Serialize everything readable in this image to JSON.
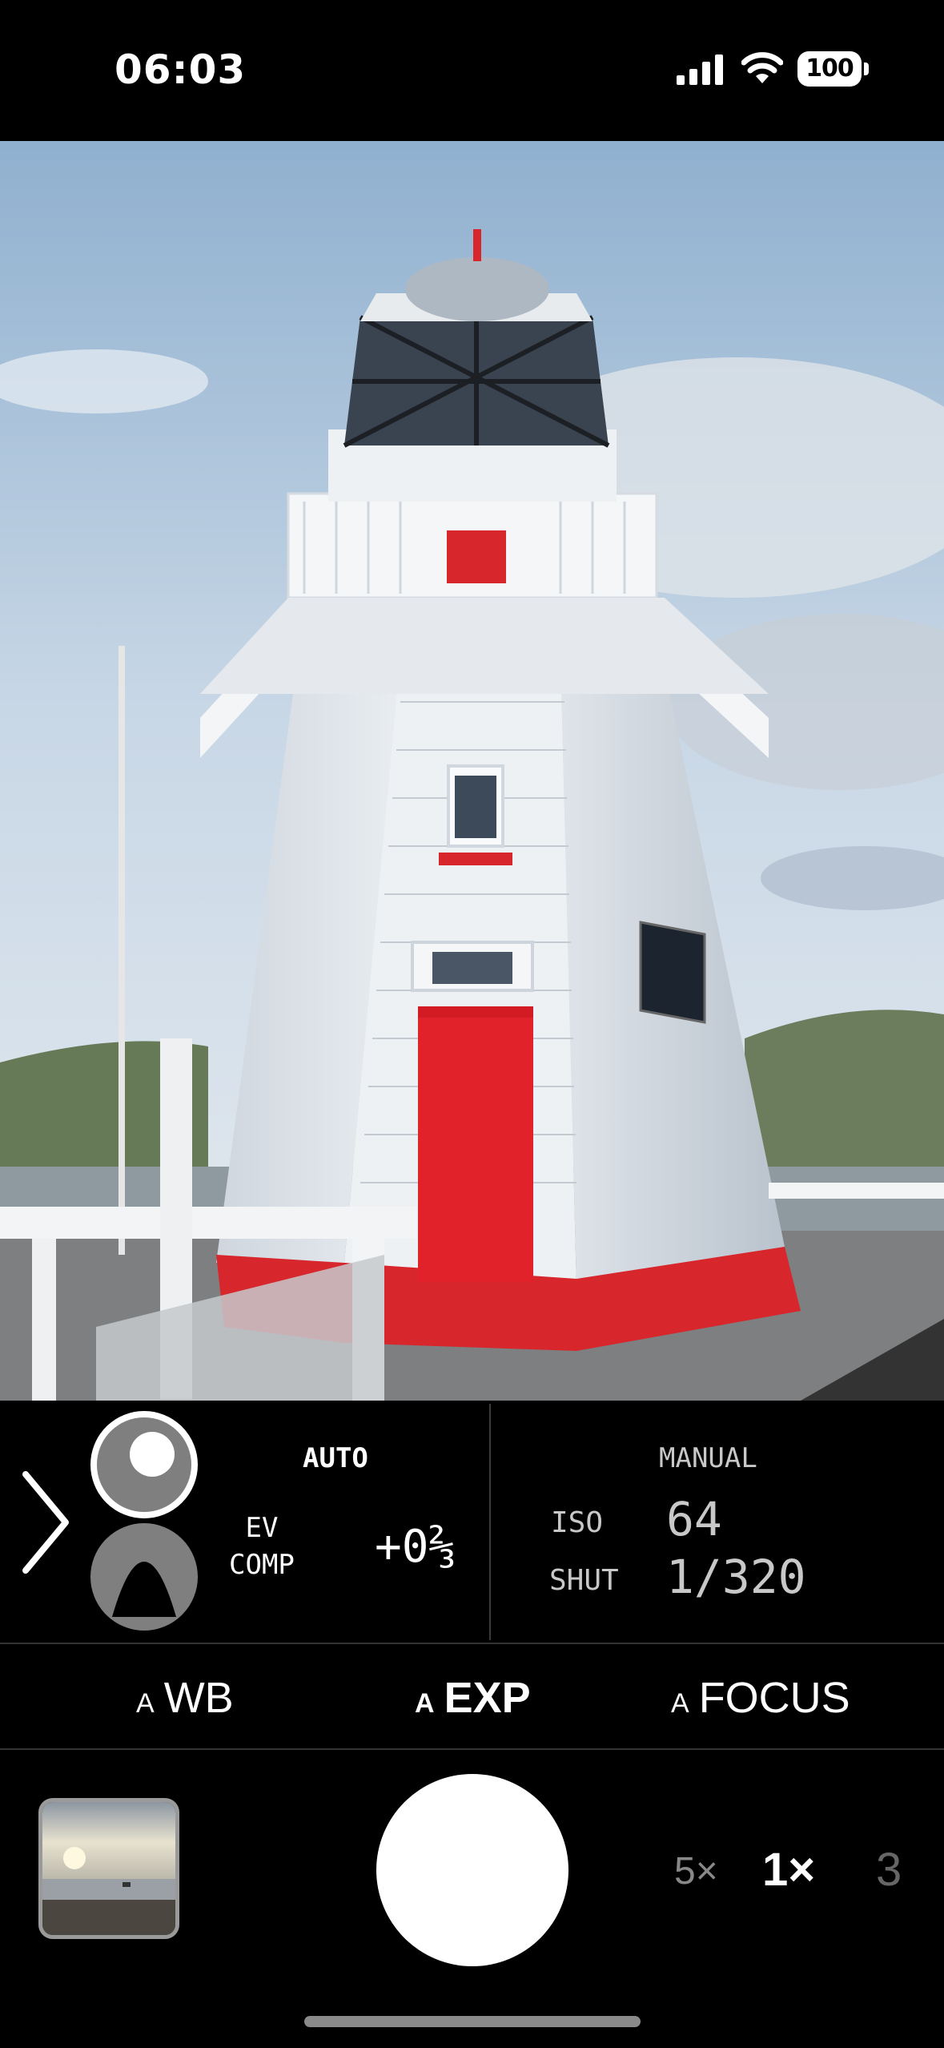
{
  "status_bar": {
    "time": "06:03",
    "battery": "100",
    "signal_icon": "cellular-signal-icon",
    "wifi_icon": "wifi-icon"
  },
  "exposure_panel": {
    "expand_icon": "chevron-right-icon",
    "auto_label": "AUTO",
    "ev_label_line1": "EV",
    "ev_label_line2": "COMP",
    "ev_value": "+0⅔",
    "manual_label": "MANUAL",
    "iso_label": "ISO",
    "iso_value": "64",
    "shutter_label": "SHUT",
    "shutter_value": "1/320"
  },
  "mode_tabs": [
    {
      "prefix": "A",
      "label": "WB",
      "active": false
    },
    {
      "prefix": "A",
      "label": "EXP",
      "active": true
    },
    {
      "prefix": "A",
      "label": "FOCUS",
      "active": false
    }
  ],
  "zoom": {
    "left": "5×",
    "current": "1×",
    "right": "3"
  },
  "colors": {
    "accent_red": "#e1222a",
    "background": "#000000"
  }
}
